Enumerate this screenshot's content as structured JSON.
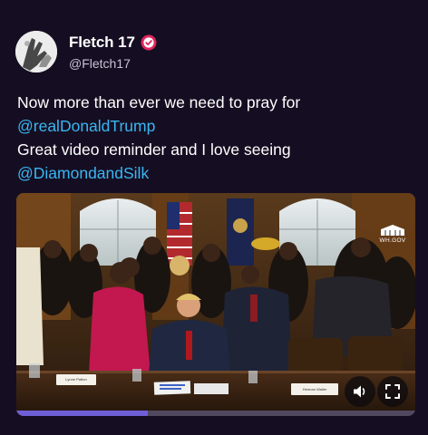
{
  "author": {
    "display_name": "Fletch 17",
    "handle": "@Fletch17",
    "verified": true,
    "avatar_icon": "avatar-hands-icon",
    "verified_color": "#e0245e"
  },
  "tweet": {
    "lines": [
      {
        "text": "Now more than ever we need to pray for",
        "mention": false
      },
      {
        "text": "@realDonaldTrump",
        "mention": true
      },
      {
        "text": "Great video reminder and I love seeing",
        "mention": false
      },
      {
        "text": "@DiamondandSilk",
        "mention": true
      }
    ],
    "mention_color": "#39b6f3"
  },
  "media": {
    "type": "video",
    "watermark": "WH.GOV",
    "watermark_icon": "white-house-icon",
    "placards": [
      "Lynne Patton",
      "",
      "Herman Waller",
      ""
    ],
    "progress": 0.33,
    "progress_color": "#6f5fd6",
    "mute_icon": "speaker-muted-icon",
    "fullscreen_icon": "fullscreen-icon"
  }
}
